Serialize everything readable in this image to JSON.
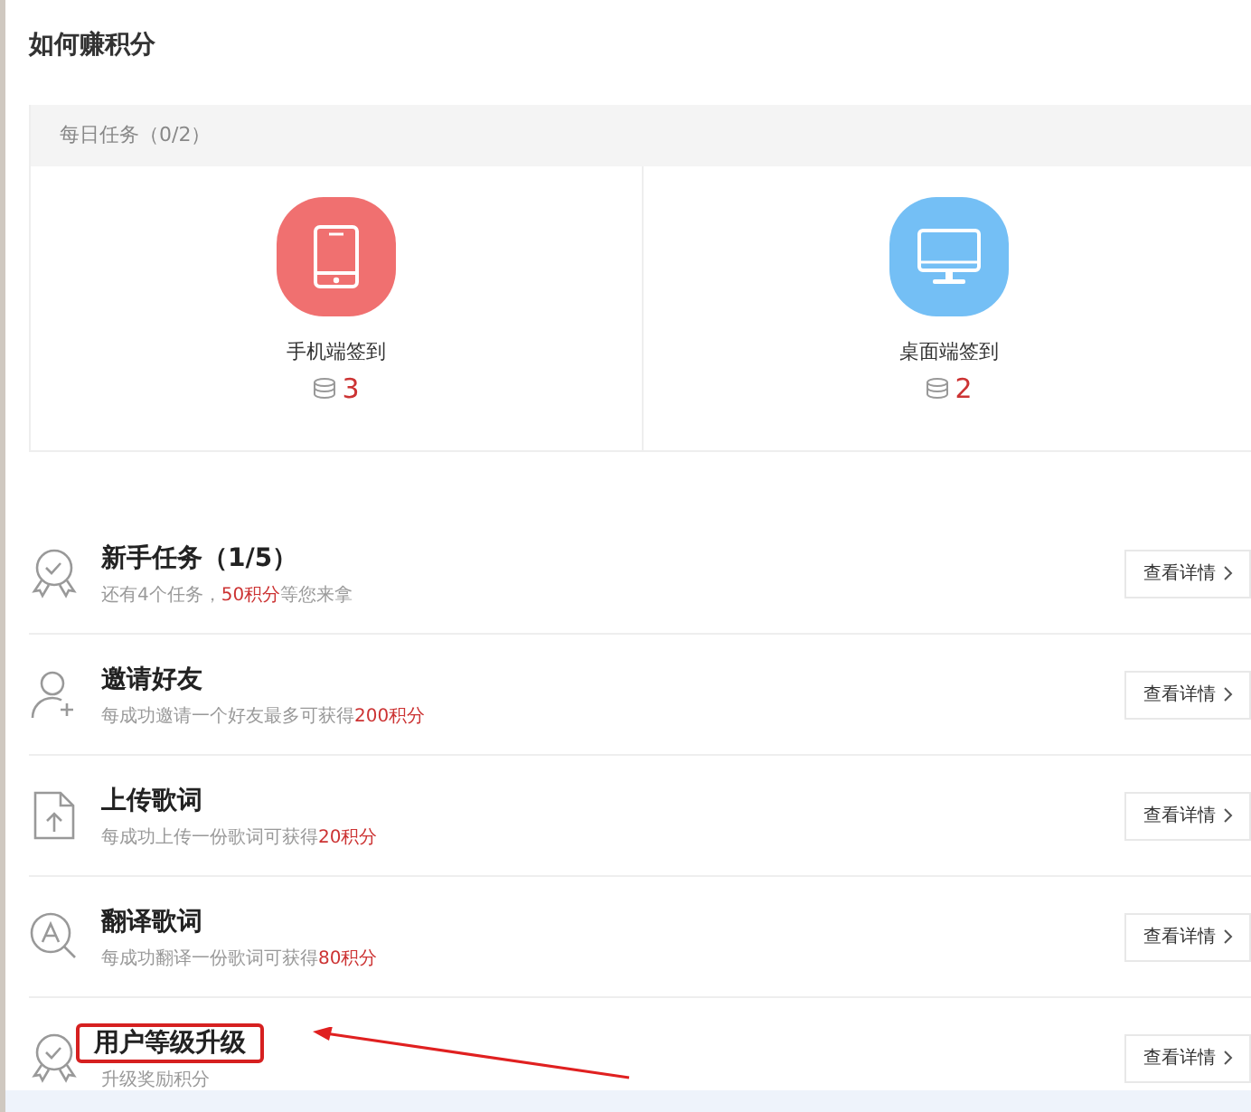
{
  "title": "如何赚积分",
  "daily": {
    "header": "每日任务（0/2）",
    "items": [
      {
        "kind": "phone",
        "color": "#f07070",
        "label": "手机端签到",
        "points": "3"
      },
      {
        "kind": "desktop",
        "color": "#74bff5",
        "label": "桌面端签到",
        "points": "2"
      }
    ]
  },
  "tasks": [
    {
      "kind": "medal",
      "title": "新手任务（1/5）",
      "desc": "还有4个任务，",
      "reward": "50积分",
      "desc_after": "等您来拿",
      "button": "查看详情",
      "highlighted": false
    },
    {
      "kind": "user-add",
      "title": "邀请好友",
      "desc": "每成功邀请一个好友最多可获得",
      "reward": "200积分",
      "button": "查看详情",
      "highlighted": false
    },
    {
      "kind": "upload",
      "title": "上传歌词",
      "desc": "每成功上传一份歌词可获得",
      "reward": "20积分",
      "button": "查看详情",
      "highlighted": false
    },
    {
      "kind": "translate",
      "title": "翻译歌词",
      "desc": "每成功翻译一份歌词可获得",
      "reward": "80积分",
      "button": "查看详情",
      "highlighted": false
    },
    {
      "kind": "medal",
      "title": "用户等级升级",
      "desc": "升级奖励积分",
      "button": "查看详情",
      "highlighted": true
    }
  ]
}
